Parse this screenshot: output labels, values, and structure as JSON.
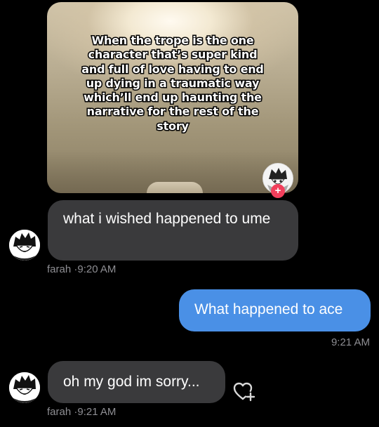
{
  "shared_post": {
    "caption": "When the trope is the one character that’s super kind and full of love having to end up dying in a traumatic way which’ll end up haunting the narrative for the rest of the story",
    "follow_badge": "+"
  },
  "messages": [
    {
      "direction": "incoming",
      "text": "what i wished happened to ume",
      "sender": "farah",
      "separator": "·",
      "time": "9:20 AM"
    },
    {
      "direction": "outgoing",
      "text": "What happened to ace",
      "time": "9:21 AM"
    },
    {
      "direction": "incoming",
      "text": "oh my god im sorry...",
      "sender": "farah",
      "separator": "·",
      "time": "9:21 AM"
    }
  ],
  "icons": {
    "reaction": "heart-plus-icon",
    "avatar": "anime-avatar-icon"
  },
  "colors": {
    "background": "#000000",
    "incoming_bubble": "#3a3a3c",
    "outgoing_bubble": "#4a90e6",
    "meta_text": "#8e8e93",
    "follow_badge": "#f23f5c"
  }
}
